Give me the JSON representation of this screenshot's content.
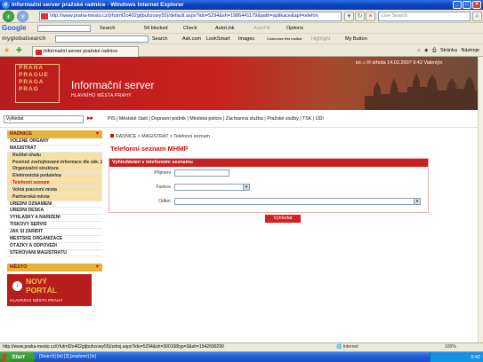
{
  "window": {
    "title": "Informační server pražské radnice - Windows Internet Explorer",
    "controls": {
      "minimize": "_",
      "maximize": "□",
      "close": "×"
    }
  },
  "address_bar": {
    "url": "http://www.praha-mesto.cz/(rfutrnf2o402gtjbuhzowy55)/default.aspx?ido=5294&sh=1986441179&path=aplikace&apl=telefon",
    "search_placeholder": "Live Search"
  },
  "google_bar": {
    "logo": "Google",
    "search_label": "Search",
    "blocked": "54 blocked",
    "check": "Check",
    "autolink": "AutoLink",
    "autofill": "AutoFill",
    "options": "Options"
  },
  "mysearch_bar": {
    "logo": "myglobalsearch",
    "search_label": "Search",
    "ask": "Ask.com",
    "looksmart": "LookSmart",
    "images": "Images",
    "customize": "Customize this toolbar",
    "highlight": "Highlight",
    "mybutton": "My Button"
  },
  "tab": {
    "label": "Informační server pražské radnice"
  },
  "commandbar": {
    "page": "Stránka",
    "tools": "Nástroje"
  },
  "site": {
    "praha_words": [
      "PRAHA",
      "PRAGUE",
      "PRAGA",
      "PRAG"
    ],
    "title": "Informační server",
    "subtitle": "HLAVNÍHO MĚSTA PRAHY",
    "date_line": "středa 14.02.2007 9:42 Valentýn",
    "top_icons": "txt",
    "search_value": "Vyhledat",
    "links": [
      "PIS",
      "Městské části",
      "Dopravní podnik",
      "Městská policie",
      "Záchranná služba",
      "Pražské služby",
      "TSK",
      "ÚDI"
    ]
  },
  "sidebar": {
    "head1": "RADNICE",
    "items": [
      {
        "label": "VOLENÉ ORGÁNY",
        "type": "main"
      },
      {
        "label": "MAGISTRÁT",
        "type": "main"
      },
      {
        "label": "Ředitel úřadu",
        "type": "sub"
      },
      {
        "label": "Povinně zveřejňované informace dle zák. 106",
        "type": "sub"
      },
      {
        "label": "Organizační struktura",
        "type": "sub"
      },
      {
        "label": "Elektronická podatelna",
        "type": "sub"
      },
      {
        "label": "Telefonní seznam",
        "type": "active"
      },
      {
        "label": "Volná pracovní místa",
        "type": "sub"
      },
      {
        "label": "Partnerská města",
        "type": "sub"
      },
      {
        "label": "ÚŘEDNÍ OZNÁMENÍ",
        "type": "main"
      },
      {
        "label": "ÚŘEDNÍ DESKA",
        "type": "main"
      },
      {
        "label": "VYHLÁŠKY A NAŘÍZENÍ",
        "type": "main"
      },
      {
        "label": "TISKOVÝ SERVIS",
        "type": "main"
      },
      {
        "label": "JAK SI ZAŘÍDIT",
        "type": "main"
      },
      {
        "label": "MĚSTSKÉ ORGANIZACE",
        "type": "main"
      },
      {
        "label": "OTÁZKY A ODPOVĚDI",
        "type": "main"
      },
      {
        "label": "STĚHOVÁNÍ MAGISTRÁTU",
        "type": "main"
      }
    ],
    "head2": "MĚSTO",
    "banner": {
      "line1": "NOVÝ",
      "line2": "PORTÁL",
      "line3": "HLAVNÍHO MĚSTA PRAHY"
    }
  },
  "content": {
    "breadcrumb": "RADNICE > MAGISTRÁT > Telefonní seznam",
    "page_title": "Telefonní seznam MHMP",
    "form_title": "Vyhledávání v telefonním seznamu",
    "label_surname": "Příjmení",
    "label_function": "Funkce",
    "label_department": "Odbor",
    "search_button": "Vyhledat"
  },
  "statusbar": {
    "url": "http://www.praha-mesto.cz/(rfutrnf2o402gtjbuhzowy55)/zdroj.aspx?ido=5294&sh=300108typ=3&sh=1542690290",
    "zone": "Internet",
    "zoom": "100%"
  },
  "taskbar": {
    "start": "Start",
    "items": "[Search] [ie] [3] [explorer] [ie]",
    "time": "9:42"
  },
  "colors": {
    "accent_red": "#c91f1f",
    "sidebar_yellow": "#e8b33b",
    "sidebar_sub": "#f6e0a6"
  }
}
